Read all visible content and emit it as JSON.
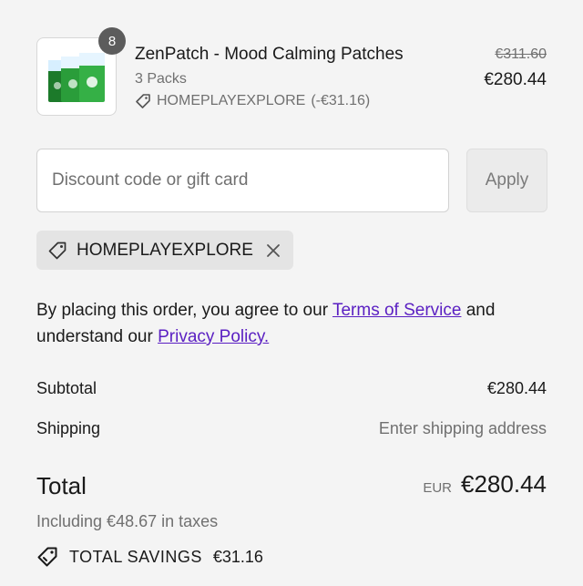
{
  "product": {
    "name": "ZenPatch - Mood Calming Patches",
    "variant": "3 Packs",
    "quantity": "8",
    "discount_code": "HOMEPLAYEXPLORE",
    "discount_amount": "(-€31.16)",
    "original_price": "€311.60",
    "price": "€280.44",
    "image_icon": "product-box-icon",
    "colors": {
      "box": "#2a9d3a",
      "box_dark": "#1c7a2a",
      "box_top": "#d7efff"
    }
  },
  "discount": {
    "placeholder": "Discount code or gift card",
    "value": "",
    "apply_label": "Apply",
    "applied_code": "HOMEPLAYEXPLORE"
  },
  "legal": {
    "prefix": "By placing this order, you agree to our ",
    "terms_link": "Terms of Service",
    "middle": " and understand our ",
    "privacy_link": "Privacy Policy."
  },
  "summary": {
    "subtotal_label": "Subtotal",
    "subtotal_value": "€280.44",
    "shipping_label": "Shipping",
    "shipping_value": "Enter shipping address",
    "total_label": "Total",
    "currency": "EUR",
    "total_value": "€280.44",
    "taxes": "Including €48.67 in taxes",
    "savings_label": "TOTAL SAVINGS",
    "savings_value": "€31.16"
  },
  "colors": {
    "background": "#f4f4f4",
    "link": "#5a1fc2",
    "muted_text": "#707070"
  }
}
